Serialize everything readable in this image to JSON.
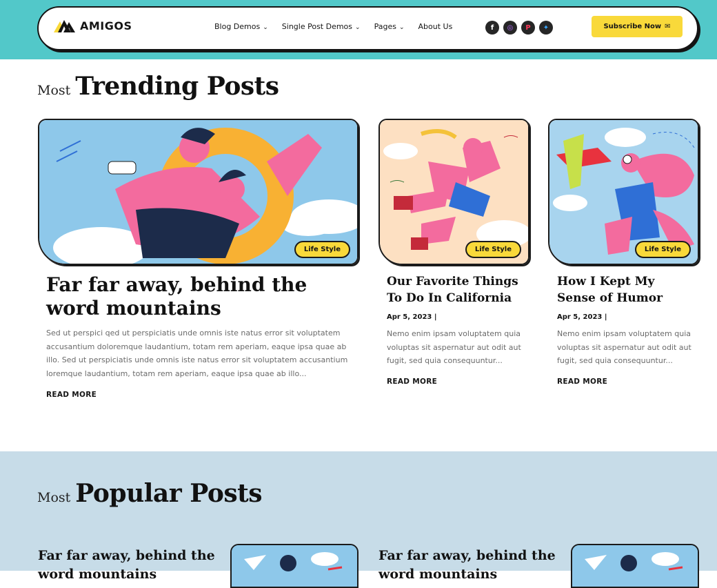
{
  "header": {
    "logo_text": "AMIGOS",
    "menu": [
      {
        "label": "Blog Demos",
        "has_dropdown": true
      },
      {
        "label": "Single Post Demos",
        "has_dropdown": true
      },
      {
        "label": "Pages",
        "has_dropdown": true
      },
      {
        "label": "About Us",
        "has_dropdown": false
      }
    ],
    "socials": [
      {
        "icon": "facebook-icon",
        "glyph": "f"
      },
      {
        "icon": "instagram-icon",
        "glyph": "◎"
      },
      {
        "icon": "pinterest-icon",
        "glyph": "P"
      },
      {
        "icon": "twitter-icon",
        "glyph": "✦"
      }
    ],
    "subscribe_label": "Subscribe Now",
    "subscribe_icon": "envelope-icon"
  },
  "trending": {
    "small": "Most",
    "big": "Trending Posts",
    "main_post": {
      "category": "Life Style",
      "title": "Far far away, behind the word mountains",
      "excerpt": "Sed ut perspici qed ut perspiciatis unde omnis iste natus error sit voluptatem accusantium doloremque laudantium, totam rem aperiam, eaque ipsa quae ab illo. Sed ut perspiciatis unde omnis iste natus error sit voluptatem accusantium loremque laudantium, totam rem aperiam, eaque ipsa quae ab illo...",
      "read_more": "READ MORE"
    },
    "posts": [
      {
        "category": "Life Style",
        "title": "Our Favorite Things To Do In California",
        "date": "Apr 5, 2023 |",
        "excerpt": "Nemo enim ipsam voluptatem quia voluptas sit aspernatur aut odit aut fugit, sed quia consequuntur...",
        "read_more": "READ MORE"
      },
      {
        "category": "Life Style",
        "title": "How I Kept My Sense of Humor",
        "date": "Apr 5, 2023 |",
        "excerpt": "Nemo enim ipsam voluptatem quia voluptas sit aspernatur aut odit aut fugit, sed quia consequuntur...",
        "read_more": "READ MORE"
      }
    ]
  },
  "popular": {
    "small": "Most",
    "big": "Popular Posts",
    "posts": [
      {
        "title": "Far far away, behind the word mountains"
      },
      {
        "title": "Far far away, behind the word mountains"
      }
    ]
  },
  "colors": {
    "header_band": "#52c8c9",
    "accent_yellow": "#f9d93a",
    "popular_bg": "#c7dce8"
  }
}
